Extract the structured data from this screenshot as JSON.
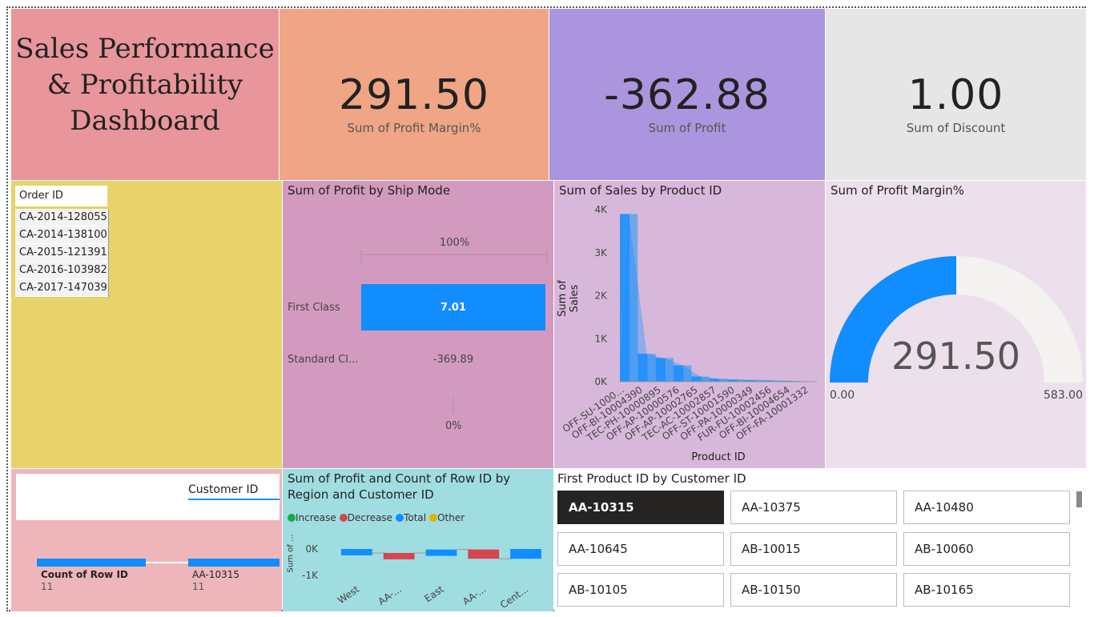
{
  "title": {
    "line1": "Sales Performance",
    "line2": "& Profitability",
    "line3": "Dashboard"
  },
  "kpis": [
    {
      "value": "291.50",
      "label": "Sum of Profit Margin%"
    },
    {
      "value": "-362.88",
      "label": "Sum of Profit"
    },
    {
      "value": "1.00",
      "label": "Sum of Discount"
    }
  ],
  "colors": {
    "title_bg": "#e8959b",
    "kpi1_bg": "#f0a586",
    "kpi2_bg": "#ab95de",
    "kpi3_bg": "#e6e6e6",
    "slicer_bg": "#e8d26a",
    "ship_bg": "#d39ac0",
    "sales_bg": "#d8b8da",
    "gauge_bg": "#ede0ed",
    "cust_bg": "#eeb6bb",
    "water_bg": "#a0dde0",
    "accent": "#118dff"
  },
  "order_slicer": {
    "header": "Order ID",
    "items": [
      "CA-2014-128055",
      "CA-2014-138100",
      "CA-2015-121391",
      "CA-2016-103982",
      "CA-2017-147039"
    ]
  },
  "ship_mode": {
    "title": "Sum of Profit by Ship Mode",
    "top_pct": "100%",
    "bottom_pct": "0%",
    "rows": [
      {
        "label": "First Class",
        "value": "7.01"
      },
      {
        "label": "Standard Cl...",
        "value": "-369.89"
      }
    ]
  },
  "sales_product": {
    "title": "Sum of Sales by Product ID",
    "xlabel": "Product ID",
    "ylabel": "Sum of Sales",
    "ticks": [
      "0K",
      "1K",
      "2K",
      "3K",
      "4K"
    ],
    "categories": [
      "OFF-SU-1000...",
      "OFF-BI-10004390",
      "TEC-PH-10000895",
      "OFF-AP-10000576",
      "OFF-AP-10002765",
      "TEC-AC-10002857",
      "OFF-ST-10001590",
      "OFF-PA-10000349",
      "FUR-FU-10002456",
      "OFF-BI-10004654",
      "OFF-FA-10001332"
    ]
  },
  "gauge": {
    "title": "Sum of Profit Margin%",
    "value_text": "291.50",
    "min": "0.00",
    "max": "583.00",
    "fraction": 0.5
  },
  "customer_funnel": {
    "header": "Customer ID",
    "metric_label": "Count of Row ID",
    "metric_value": "11",
    "customer_label": "AA-10315",
    "customer_value": "11"
  },
  "waterfall": {
    "title_line1": "Sum of Profit and Count of Row ID by",
    "title_line2": "Region and Customer ID",
    "legend": [
      {
        "label": "Increase",
        "color": "#1aab40"
      },
      {
        "label": "Decrease",
        "color": "#d64550"
      },
      {
        "label": "Total",
        "color": "#118dff"
      },
      {
        "label": "Other",
        "color": "#e0b400"
      }
    ],
    "ylabel": "Sum of ...",
    "ticks": [
      "0K",
      "-1K"
    ],
    "categories": [
      "West",
      "AA-...",
      "East",
      "AA-...",
      "Cent..."
    ]
  },
  "first_product": {
    "title": "First Product ID by Customer ID",
    "items": [
      "AA-10315",
      "AA-10375",
      "AA-10480",
      "AA-10645",
      "AB-10015",
      "AB-10060",
      "AB-10105",
      "AB-10150",
      "AB-10165"
    ],
    "selected": "AA-10315"
  },
  "chart_data": [
    {
      "type": "bar",
      "title": "Sum of Profit by Ship Mode",
      "categories": [
        "First Class",
        "Standard Cl..."
      ],
      "values": [
        7.01,
        -369.89
      ]
    },
    {
      "type": "area",
      "title": "Sum of Sales by Product ID",
      "xlabel": "Product ID",
      "ylabel": "Sum of Sales",
      "categories": [
        "OFF-SU-1000...",
        "OFF-BI-10004390",
        "TEC-PH-10000895",
        "OFF-AP-10000576",
        "OFF-AP-10002765",
        "TEC-AC-10002857",
        "OFF-ST-10001590",
        "OFF-PA-10000349",
        "FUR-FU-10002456",
        "OFF-BI-10004654",
        "OFF-FA-10001332"
      ],
      "values": [
        3900,
        650,
        550,
        380,
        120,
        70,
        50,
        40,
        30,
        20,
        10
      ],
      "ylim": [
        0,
        4000
      ]
    },
    {
      "type": "bar",
      "title": "Sum of Profit and Count of Row ID by Region and Customer ID",
      "categories": [
        "West",
        "AA-...",
        "East",
        "AA-...",
        "Cent..."
      ],
      "values": [
        -150,
        -150,
        -20,
        -370,
        -370
      ],
      "ylim": [
        -1000,
        0
      ]
    }
  ]
}
